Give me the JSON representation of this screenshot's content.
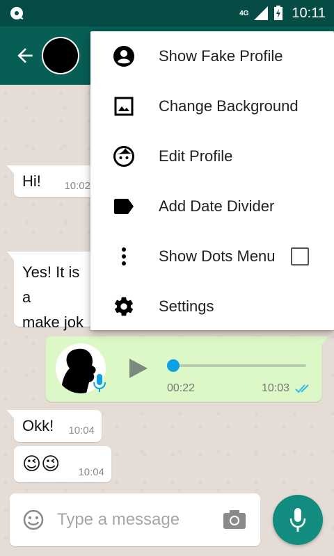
{
  "status_bar": {
    "network": "4G",
    "time": "10:11"
  },
  "menu": {
    "items": [
      {
        "label": "Show Fake Profile",
        "icon": "account-circle-icon"
      },
      {
        "label": "Change Background",
        "icon": "image-icon"
      },
      {
        "label": "Edit Profile",
        "icon": "face-icon"
      },
      {
        "label": "Add Date Divider",
        "icon": "label-icon"
      },
      {
        "label": "Show Dots Menu",
        "icon": "dots-vertical-icon",
        "checked": false
      },
      {
        "label": "Settings",
        "icon": "gear-icon"
      }
    ]
  },
  "messages": {
    "hi": {
      "text": "Hi!",
      "time": "10:02"
    },
    "yes": {
      "line1": "Yes! It is a",
      "line2": "make jok"
    },
    "audio": {
      "duration": "00:22",
      "time": "10:03",
      "progress": 0.0
    },
    "okk": {
      "text": "Okk!",
      "time": "10:04"
    },
    "emoji": {
      "text": "😉😉",
      "time": "10:04"
    }
  },
  "composer": {
    "placeholder": "Type a message"
  },
  "colors": {
    "header": "#075e54",
    "status_bar": "#054d44",
    "accent": "#128c7e",
    "outgoing_bubble": "#dcf8c6",
    "read_ticks": "#34b7f1"
  }
}
